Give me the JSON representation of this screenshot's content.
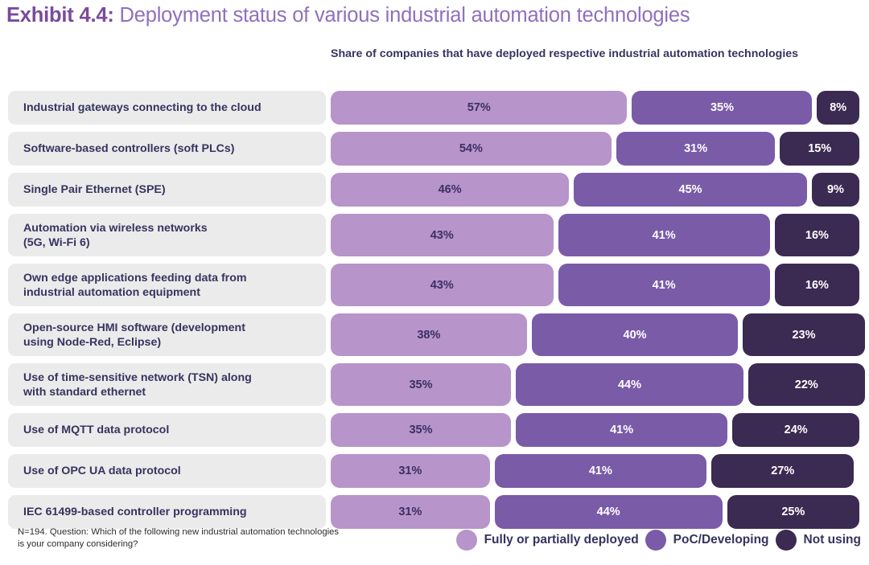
{
  "title": {
    "prefix": "Exhibit 4.4:",
    "text": " Deployment status of various industrial automation technologies",
    "prefix_color": "#7a4a9e",
    "text_color": "#8e70bd"
  },
  "subtitle": "Share of companies that have deployed respective industrial automation technologies",
  "footnote": "N=194. Question: Which of the following new industrial automation technologies is your company considering?",
  "legend": {
    "items": [
      {
        "label": "Fully or partially deployed",
        "color": "#b794c9"
      },
      {
        "label": "PoC/Developing",
        "color": "#7a5ba8"
      },
      {
        "label": "Not using",
        "color": "#3b2a52"
      }
    ]
  },
  "chart_data": {
    "type": "bar",
    "subtype": "stacked-horizontal-100",
    "title": "Exhibit 4.4: Deployment status of various industrial automation technologies",
    "subtitle": "Share of companies that have deployed respective industrial automation technologies",
    "xlabel": "",
    "ylabel": "",
    "xlim": [
      0,
      100
    ],
    "unit": "%",
    "grid": false,
    "legend_position": "bottom-right",
    "note": "N=194. Question: Which of the following new industrial automation technologies is your company considering?",
    "colors": [
      "#b794c9",
      "#7a5ba8",
      "#3b2a52"
    ],
    "categories": [
      "Industrial gateways connecting to the cloud",
      "Software-based controllers (soft PLCs)",
      "Single Pair Ethernet (SPE)",
      "Automation via wireless networks\n(5G, Wi-Fi 6)",
      "Own edge applications feeding data from\nindustrial automation equipment",
      "Open-source HMI software (development\nusing Node-Red, Eclipse)",
      "Use of time-sensitive network (TSN) along\nwith standard ethernet",
      "Use of MQTT data protocol",
      "Use of OPC UA data protocol",
      "IEC 61499-based controller programming"
    ],
    "series": [
      {
        "name": "Fully or partially deployed",
        "color": "#b794c9",
        "values": [
          57,
          54,
          46,
          43,
          43,
          38,
          35,
          35,
          31,
          31
        ]
      },
      {
        "name": "PoC/Developing",
        "color": "#7a5ba8",
        "values": [
          35,
          31,
          45,
          41,
          41,
          40,
          44,
          41,
          41,
          44
        ]
      },
      {
        "name": "Not using",
        "color": "#3b2a52",
        "values": [
          8,
          15,
          9,
          16,
          16,
          23,
          22,
          24,
          27,
          25
        ]
      }
    ],
    "rows": [
      {
        "label": "Industrial gateways connecting to the cloud",
        "lines": 1,
        "values": [
          57,
          35,
          8
        ],
        "labels": [
          "57%",
          "35%",
          "8%"
        ]
      },
      {
        "label": "Software-based controllers (soft PLCs)",
        "lines": 1,
        "values": [
          54,
          31,
          15
        ],
        "labels": [
          "54%",
          "31%",
          "15%"
        ]
      },
      {
        "label": "Single Pair Ethernet (SPE)",
        "lines": 1,
        "values": [
          46,
          45,
          9
        ],
        "labels": [
          "46%",
          "45%",
          "9%"
        ]
      },
      {
        "label": "Automation via wireless networks\n(5G, Wi-Fi 6)",
        "lines": 2,
        "values": [
          43,
          41,
          16
        ],
        "labels": [
          "43%",
          "41%",
          "16%"
        ]
      },
      {
        "label": "Own edge applications feeding data from\nindustrial automation equipment",
        "lines": 2,
        "values": [
          43,
          41,
          16
        ],
        "labels": [
          "43%",
          "41%",
          "16%"
        ]
      },
      {
        "label": "Open-source HMI software (development\nusing Node-Red, Eclipse)",
        "lines": 2,
        "values": [
          38,
          40,
          23
        ],
        "labels": [
          "38%",
          "40%",
          "23%"
        ]
      },
      {
        "label": "Use of time-sensitive network (TSN) along\nwith standard ethernet",
        "lines": 2,
        "values": [
          35,
          44,
          22
        ],
        "labels": [
          "35%",
          "44%",
          "22%"
        ]
      },
      {
        "label": "Use of MQTT data protocol",
        "lines": 1,
        "values": [
          35,
          41,
          24
        ],
        "labels": [
          "35%",
          "41%",
          "24%"
        ]
      },
      {
        "label": "Use of OPC UA data protocol",
        "lines": 1,
        "values": [
          31,
          41,
          27
        ],
        "labels": [
          "31%",
          "41%",
          "27%"
        ]
      },
      {
        "label": "IEC 61499-based controller programming",
        "lines": 1,
        "values": [
          31,
          44,
          25
        ],
        "labels": [
          "31%",
          "44%",
          "25%"
        ]
      }
    ]
  }
}
